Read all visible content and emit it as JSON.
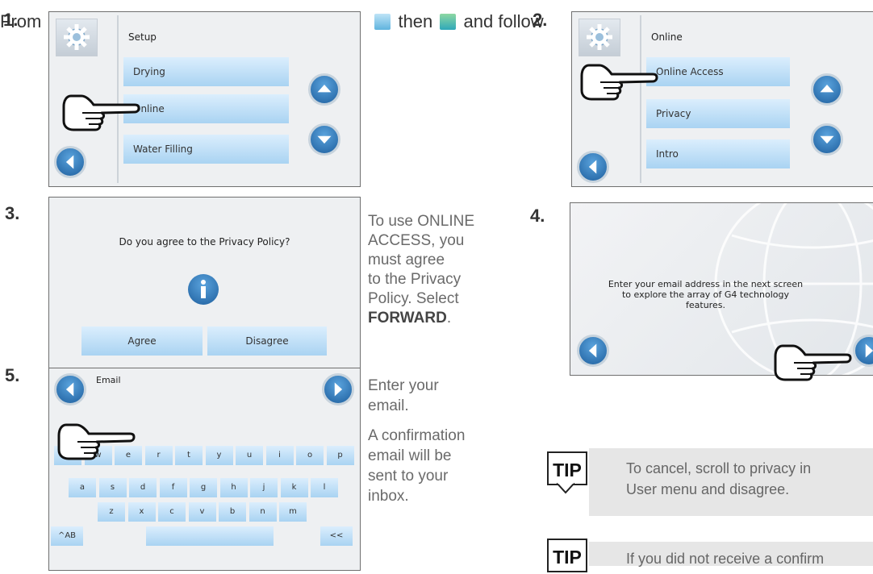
{
  "intro": {
    "part1": "From",
    "part2": "then",
    "part3": "and follow",
    "gear_icon": "settings-gear-icon",
    "user_icon": "online-user-icon"
  },
  "steps": [
    "1.",
    "2.",
    "3.",
    "4.",
    "5."
  ],
  "screen1": {
    "title": "Setup",
    "items": [
      "Drying",
      "Online",
      "Water Filling"
    ]
  },
  "screen2": {
    "title": "Online",
    "items": [
      "Online Access",
      "Privacy",
      "Intro"
    ]
  },
  "screen3": {
    "question": "Do you agree to the Privacy Policy?",
    "agree": "Agree",
    "disagree": "Disagree"
  },
  "step3_text": {
    "line1": "To use ONLINE",
    "line2": "ACCESS, you",
    "line3": "must agree",
    "line4": "to the Privacy",
    "line5": "Policy. Select",
    "bold": "FORWARD",
    "end": "."
  },
  "screen4": {
    "line1": "Enter your email address in the next screen",
    "line2": "to explore the array of G4 technology",
    "line3": "features."
  },
  "screen5": {
    "title": "Email",
    "row1": [
      "q",
      "w",
      "e",
      "r",
      "t",
      "y",
      "u",
      "i",
      "o",
      "p"
    ],
    "row2": [
      "a",
      "s",
      "d",
      "f",
      "g",
      "h",
      "j",
      "k",
      "l"
    ],
    "row3": [
      "z",
      "x",
      "c",
      "v",
      "b",
      "n",
      "m"
    ],
    "shift": "^AB",
    "backspace": "<<"
  },
  "step5_text": {
    "line1": "Enter your",
    "line2": "email.",
    "line3": "A confirmation",
    "line4": "email will be",
    "line5": "sent to your",
    "line6": "inbox."
  },
  "tips": [
    {
      "label": "TIP",
      "line1": "To cancel, scroll to privacy in",
      "line2": "User menu and disagree."
    },
    {
      "label": "TIP",
      "line1": "If you did not receive a confirm",
      "line2": ""
    }
  ],
  "colors": {
    "button_blue": "#1e5f9e",
    "menu_light": "#dbeefd",
    "screen_bg": "#eef0f2"
  }
}
